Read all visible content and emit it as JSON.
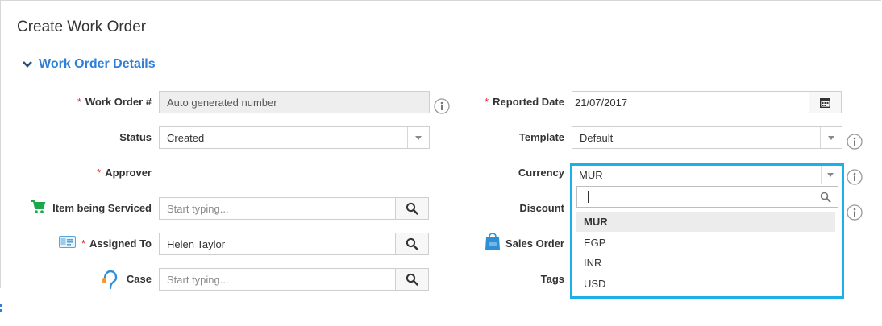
{
  "page": {
    "title": "Create Work Order"
  },
  "section": {
    "title": "Work Order Details"
  },
  "required_marker": "*",
  "left": {
    "work_order": {
      "label": "Work Order #",
      "value": "Auto generated number"
    },
    "status": {
      "label": "Status",
      "value": "Created"
    },
    "approver": {
      "label": "Approver"
    },
    "item": {
      "label": "Item being Serviced",
      "placeholder": "Start typing..."
    },
    "assigned": {
      "label": "Assigned To",
      "value": "Helen Taylor"
    },
    "case": {
      "label": "Case",
      "placeholder": "Start typing..."
    }
  },
  "right": {
    "reported_date": {
      "label": "Reported Date",
      "value": "21/07/2017"
    },
    "template": {
      "label": "Template",
      "value": "Default"
    },
    "currency": {
      "label": "Currency",
      "value": "MUR",
      "search_value": "",
      "options": [
        "MUR",
        "EGP",
        "INR",
        "USD"
      ]
    },
    "discount": {
      "label": "Discount"
    },
    "sales_order": {
      "label": "Sales Order"
    },
    "tags": {
      "label": "Tags"
    }
  },
  "colors": {
    "accent": "#2f7fd6",
    "dropdown_border": "#1eaee8",
    "required": "#e02b2b"
  }
}
